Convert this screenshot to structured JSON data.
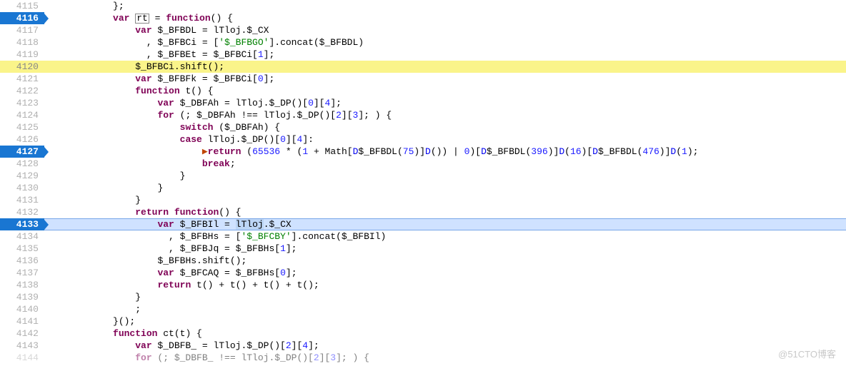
{
  "watermark": "@51CTO博客",
  "lines": [
    {
      "num": "4115",
      "indent": 10,
      "tokens": [
        {
          "c": "op",
          "t": "};"
        }
      ]
    },
    {
      "num": "4116",
      "active": true,
      "indent": 10,
      "tokens": [
        {
          "c": "kw",
          "t": "var"
        },
        {
          "t": " "
        },
        {
          "c": "id boxed",
          "t": "rt"
        },
        {
          "t": " = "
        },
        {
          "c": "kw",
          "t": "function"
        },
        {
          "c": "op",
          "t": "() {"
        }
      ]
    },
    {
      "num": "4117",
      "indent": 14,
      "tokens": [
        {
          "c": "kw",
          "t": "var"
        },
        {
          "t": " $_BFBDL = lTloj.$_CX"
        }
      ]
    },
    {
      "num": "4118",
      "indent": 16,
      "tokens": [
        {
          "t": ", $_BFBCi = ["
        },
        {
          "c": "strg",
          "t": "'$_BFBGO'"
        },
        {
          "t": "].concat($_BFBDL)"
        }
      ]
    },
    {
      "num": "4119",
      "indent": 16,
      "tokens": [
        {
          "t": ", $_BFBEt = $_BFBCi["
        },
        {
          "c": "num",
          "t": "1"
        },
        {
          "t": "];"
        }
      ]
    },
    {
      "num": "4120",
      "hl": "yellow",
      "indent": 14,
      "tokens": [
        {
          "t": "$_BFBCi.shift();"
        }
      ]
    },
    {
      "num": "4121",
      "indent": 14,
      "tokens": [
        {
          "c": "kw",
          "t": "var"
        },
        {
          "t": " $_BFBFk = $_BFBCi["
        },
        {
          "c": "num",
          "t": "0"
        },
        {
          "t": "];"
        }
      ]
    },
    {
      "num": "4122",
      "indent": 14,
      "tokens": [
        {
          "c": "kw",
          "t": "function"
        },
        {
          "t": " t() {"
        }
      ]
    },
    {
      "num": "4123",
      "indent": 18,
      "tokens": [
        {
          "c": "kw",
          "t": "var"
        },
        {
          "t": " $_DBFAh = lTloj.$_DP()["
        },
        {
          "c": "num",
          "t": "0"
        },
        {
          "t": "]["
        },
        {
          "c": "num",
          "t": "4"
        },
        {
          "t": "];"
        }
      ]
    },
    {
      "num": "4124",
      "indent": 18,
      "tokens": [
        {
          "c": "kw",
          "t": "for"
        },
        {
          "t": " (; $_DBFAh !== lTloj.$_DP()["
        },
        {
          "c": "num",
          "t": "2"
        },
        {
          "t": "]["
        },
        {
          "c": "num",
          "t": "3"
        },
        {
          "t": "]; ) {"
        }
      ]
    },
    {
      "num": "4125",
      "indent": 22,
      "tokens": [
        {
          "c": "kw",
          "t": "switch"
        },
        {
          "t": " ($_DBFAh) {"
        }
      ]
    },
    {
      "num": "4126",
      "indent": 22,
      "tokens": [
        {
          "c": "kw",
          "t": "case"
        },
        {
          "t": " lTloj.$_DP()["
        },
        {
          "c": "num",
          "t": "0"
        },
        {
          "t": "]["
        },
        {
          "c": "num",
          "t": "4"
        },
        {
          "t": "]:"
        }
      ]
    },
    {
      "num": "4127",
      "active": true,
      "indent": 26,
      "tokens": [
        {
          "c": "mark",
          "t": "▶"
        },
        {
          "c": "kw",
          "t": "return"
        },
        {
          "t": " ("
        },
        {
          "c": "num",
          "t": "65536"
        },
        {
          "t": " * ("
        },
        {
          "c": "num",
          "t": "1"
        },
        {
          "t": " + Math["
        },
        {
          "c": "lnk",
          "t": "D"
        },
        {
          "t": "$_BFBDL("
        },
        {
          "c": "num",
          "t": "75"
        },
        {
          "t": ")]"
        },
        {
          "c": "lnk",
          "t": "D"
        },
        {
          "t": "()) | "
        },
        {
          "c": "num",
          "t": "0"
        },
        {
          "t": ")["
        },
        {
          "c": "lnk",
          "t": "D"
        },
        {
          "t": "$_BFBDL("
        },
        {
          "c": "num",
          "t": "396"
        },
        {
          "t": ")]"
        },
        {
          "c": "lnk",
          "t": "D"
        },
        {
          "t": "("
        },
        {
          "c": "num",
          "t": "16"
        },
        {
          "t": ")["
        },
        {
          "c": "lnk",
          "t": "D"
        },
        {
          "t": "$_BFBDL("
        },
        {
          "c": "num",
          "t": "476"
        },
        {
          "t": ")]"
        },
        {
          "c": "lnk",
          "t": "D"
        },
        {
          "t": "("
        },
        {
          "c": "num",
          "t": "1"
        },
        {
          "t": ");"
        }
      ]
    },
    {
      "num": "4128",
      "indent": 26,
      "tokens": [
        {
          "c": "kw",
          "t": "break"
        },
        {
          "t": ";"
        }
      ]
    },
    {
      "num": "4129",
      "indent": 22,
      "tokens": [
        {
          "t": "}"
        }
      ]
    },
    {
      "num": "4130",
      "indent": 18,
      "tokens": [
        {
          "t": "}"
        }
      ]
    },
    {
      "num": "4131",
      "indent": 14,
      "tokens": [
        {
          "t": "}"
        }
      ]
    },
    {
      "num": "4132",
      "indent": 14,
      "tokens": [
        {
          "c": "kw",
          "t": "return"
        },
        {
          "t": " "
        },
        {
          "c": "kw",
          "t": "function"
        },
        {
          "t": "() {"
        }
      ]
    },
    {
      "num": "4133",
      "active": true,
      "hl": "blue",
      "indent": 18,
      "tokens": [
        {
          "c": "kw",
          "t": "var"
        },
        {
          "t": " $_BFBIl = "
        },
        {
          "c": "sel",
          "t": "lTloj"
        },
        {
          "t": ".$_CX"
        }
      ]
    },
    {
      "num": "4134",
      "indent": 20,
      "tokens": [
        {
          "t": ", $_BFBHs = ["
        },
        {
          "c": "strg",
          "t": "'$_BFCBY'"
        },
        {
          "t": "].concat($_BFBIl)"
        }
      ]
    },
    {
      "num": "4135",
      "indent": 20,
      "tokens": [
        {
          "t": ", $_BFBJq = $_BFBHs["
        },
        {
          "c": "num",
          "t": "1"
        },
        {
          "t": "];"
        }
      ]
    },
    {
      "num": "4136",
      "indent": 18,
      "tokens": [
        {
          "t": "$_BFBHs.shift();"
        }
      ]
    },
    {
      "num": "4137",
      "indent": 18,
      "tokens": [
        {
          "c": "kw",
          "t": "var"
        },
        {
          "t": " $_BFCAQ = $_BFBHs["
        },
        {
          "c": "num",
          "t": "0"
        },
        {
          "t": "];"
        }
      ]
    },
    {
      "num": "4138",
      "indent": 18,
      "tokens": [
        {
          "c": "kw",
          "t": "return"
        },
        {
          "t": " t() + t() + t() + t();"
        }
      ]
    },
    {
      "num": "4139",
      "indent": 14,
      "tokens": [
        {
          "t": "}"
        }
      ]
    },
    {
      "num": "4140",
      "indent": 14,
      "tokens": [
        {
          "t": ";"
        }
      ]
    },
    {
      "num": "4141",
      "indent": 10,
      "tokens": [
        {
          "t": "}();"
        }
      ]
    },
    {
      "num": "4142",
      "indent": 10,
      "tokens": [
        {
          "c": "kw",
          "t": "function"
        },
        {
          "t": " ct(t) {"
        }
      ]
    },
    {
      "num": "4143",
      "indent": 14,
      "tokens": [
        {
          "c": "kw",
          "t": "var"
        },
        {
          "t": " $_DBFB_ = lTloj.$_DP()["
        },
        {
          "c": "num",
          "t": "2"
        },
        {
          "t": "]["
        },
        {
          "c": "num",
          "t": "4"
        },
        {
          "t": "];"
        }
      ]
    },
    {
      "num": "4144",
      "dim": true,
      "indent": 14,
      "tokens": [
        {
          "c": "kw",
          "t": "for"
        },
        {
          "t": " (; $_DBFB_ !== lTloj.$_DP()["
        },
        {
          "c": "num",
          "t": "2"
        },
        {
          "t": "]["
        },
        {
          "c": "num",
          "t": "3"
        },
        {
          "t": "]; ) {"
        }
      ]
    }
  ]
}
